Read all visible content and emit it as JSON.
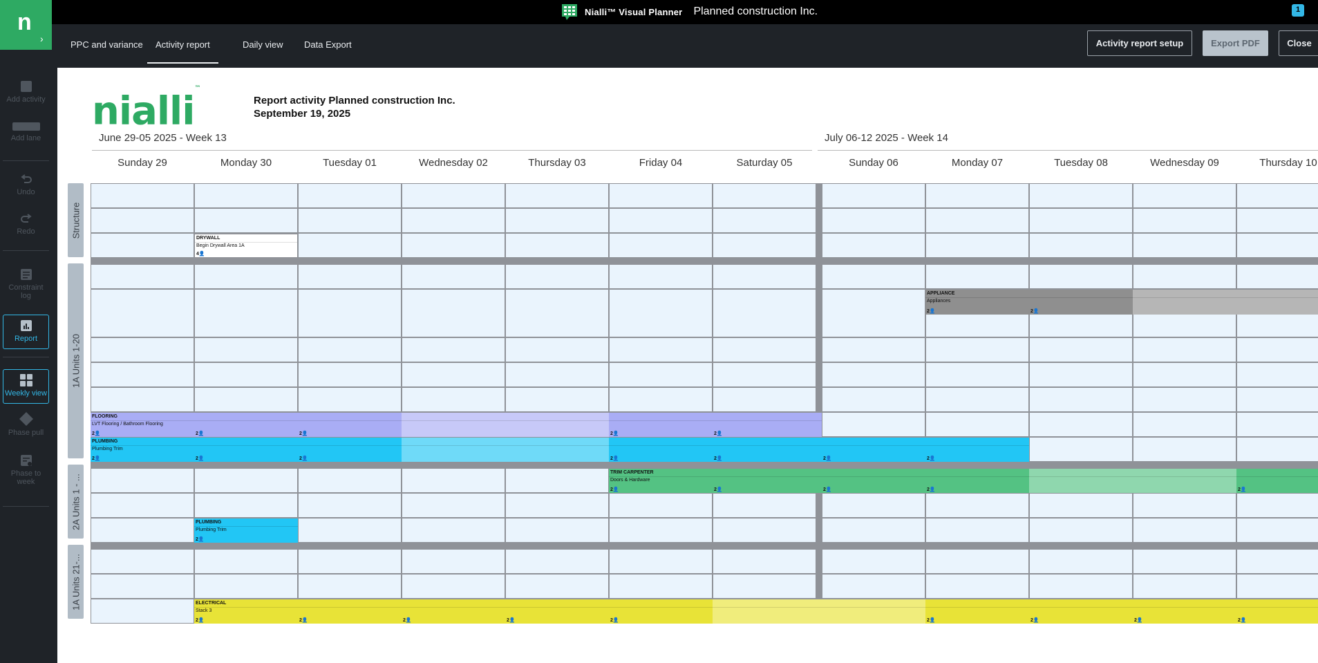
{
  "topbar": {
    "product_name": "Nialli™ Visual Planner",
    "company": "Planned construction Inc.",
    "notification_count": "1"
  },
  "applogo": {
    "letter": "n",
    "chevron": "›"
  },
  "sidebar": {
    "items": [
      {
        "label": "Add activity",
        "icon": "add-activity-icon"
      },
      {
        "label": "Add lane",
        "icon": "add-lane-icon"
      },
      {
        "label": "Undo",
        "icon": "undo-icon"
      },
      {
        "label": "Redo",
        "icon": "redo-icon"
      },
      {
        "label": "Constraint log",
        "icon": "constraint-log-icon"
      },
      {
        "label": "Report",
        "icon": "report-icon"
      },
      {
        "label": "Weekly view",
        "icon": "weekly-view-icon"
      },
      {
        "label": "Phase pull",
        "icon": "phase-pull-icon"
      },
      {
        "label": "Phase to week",
        "icon": "phase-to-week-icon"
      }
    ]
  },
  "tabs": [
    {
      "label": "PPC and variance"
    },
    {
      "label": "Activity report"
    },
    {
      "label": "Daily view"
    },
    {
      "label": "Data Export"
    }
  ],
  "buttons": {
    "setup": "Activity report setup",
    "export": "Export PDF",
    "close": "Close"
  },
  "report": {
    "brand": "nialli",
    "brand_tm": "™",
    "title_line1": "Report activity Planned construction Inc.",
    "title_line2": "September 19, 2025",
    "weeks": [
      {
        "label": "June 29-05 2025 - Week 13"
      },
      {
        "label": "July 06-12 2025 - Week 14"
      }
    ],
    "days": [
      "Sunday 29",
      "Monday 30",
      "Tuesday 01",
      "Wednesday 02",
      "Thursday 03",
      "Friday 04",
      "Saturday 05",
      "Sunday 06",
      "Monday 07",
      "Tuesday 08",
      "Wednesday 09",
      "Thursday 10"
    ],
    "lanes": [
      {
        "label": "Structure"
      },
      {
        "label": "1A Units 1-20"
      },
      {
        "label": "2A Units 1 - ..."
      },
      {
        "label": "1A Units 21-..."
      }
    ],
    "activities": [
      {
        "title": "DRYWALL",
        "subtitle": "Begin Drywall Area 1A",
        "counts": [
          "4👤"
        ]
      },
      {
        "title": "APPLIANCE",
        "subtitle": "Appliances",
        "counts": [
          "2👤",
          "2👤"
        ]
      },
      {
        "title": "FLOORING",
        "subtitle": "LVT Flooring / Bathroom Flooring",
        "counts": [
          "2👤",
          "2👤",
          "2👤",
          "2👤",
          "2👤"
        ]
      },
      {
        "title": "PLUMBING",
        "subtitle": "Plumbing Trim",
        "counts": [
          "2👤",
          "2👤",
          "2👤",
          "2👤",
          "2👤",
          "2👤",
          "2👤"
        ]
      },
      {
        "title": "TRIM CARPENTER",
        "subtitle": "Doors & Hardware",
        "counts": [
          "2👤",
          "2👤",
          "2👤",
          "2👤",
          "2👤"
        ]
      },
      {
        "title": "PLUMBING",
        "subtitle": "Plumbing Trim",
        "counts": [
          "2👤"
        ]
      },
      {
        "title": "ELECTRICAL",
        "subtitle": "Stack 3",
        "counts": [
          "2👤",
          "2👤",
          "2👤",
          "2👤",
          "2👤",
          "2👤",
          "2👤",
          "2👤",
          "2👤"
        ]
      }
    ]
  },
  "colors": {
    "brand_green": "#2eaa63",
    "flooring": "#a9adf5",
    "plumbing": "#22c6f5",
    "trim": "#54c283",
    "appliance": "#8f8f8f",
    "electrical": "#e8e337"
  }
}
